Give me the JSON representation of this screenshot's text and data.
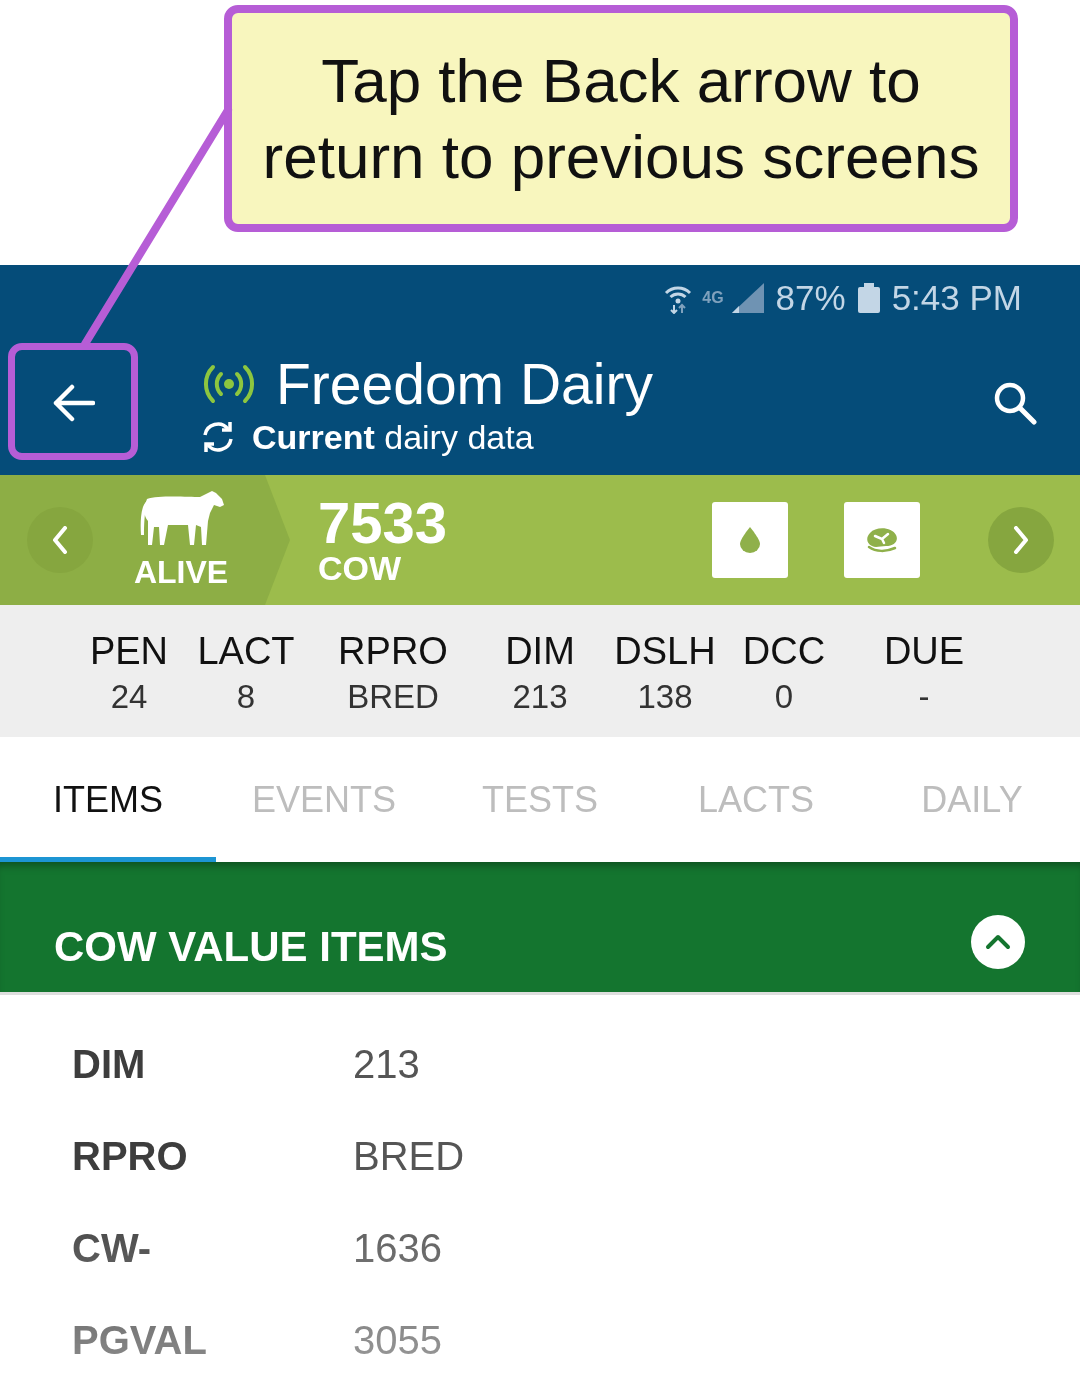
{
  "callout": {
    "text": "Tap the Back arrow to return to previous screens"
  },
  "status_bar": {
    "network": "4G",
    "battery": "87%",
    "time": "5:43 PM"
  },
  "app_bar": {
    "title": "Freedom Dairy",
    "subtitle": "**Current** dairy data"
  },
  "animal": {
    "status": "ALIVE",
    "number": "7533",
    "type": "COW"
  },
  "stats": [
    {
      "label": "PEN",
      "value": "24"
    },
    {
      "label": "LACT",
      "value": "8"
    },
    {
      "label": "RPRO",
      "value": "BRED"
    },
    {
      "label": "DIM",
      "value": "213"
    },
    {
      "label": "DSLH",
      "value": "138"
    },
    {
      "label": "DCC",
      "value": "0"
    },
    {
      "label": "DUE",
      "value": "-"
    }
  ],
  "tabs": [
    {
      "label": "ITEMS",
      "selected": true
    },
    {
      "label": "EVENTS",
      "selected": false
    },
    {
      "label": "TESTS",
      "selected": false
    },
    {
      "label": "LACTS",
      "selected": false
    },
    {
      "label": "DAILY",
      "selected": false
    }
  ],
  "section": {
    "title": "COW VALUE ITEMS",
    "expanded": true
  },
  "items": [
    {
      "label": "DIM",
      "value": "213"
    },
    {
      "label": "RPRO",
      "value": "BRED"
    },
    {
      "label": "CW-",
      "value": "1636"
    },
    {
      "label": "PGVAL",
      "value": "3055"
    }
  ]
}
